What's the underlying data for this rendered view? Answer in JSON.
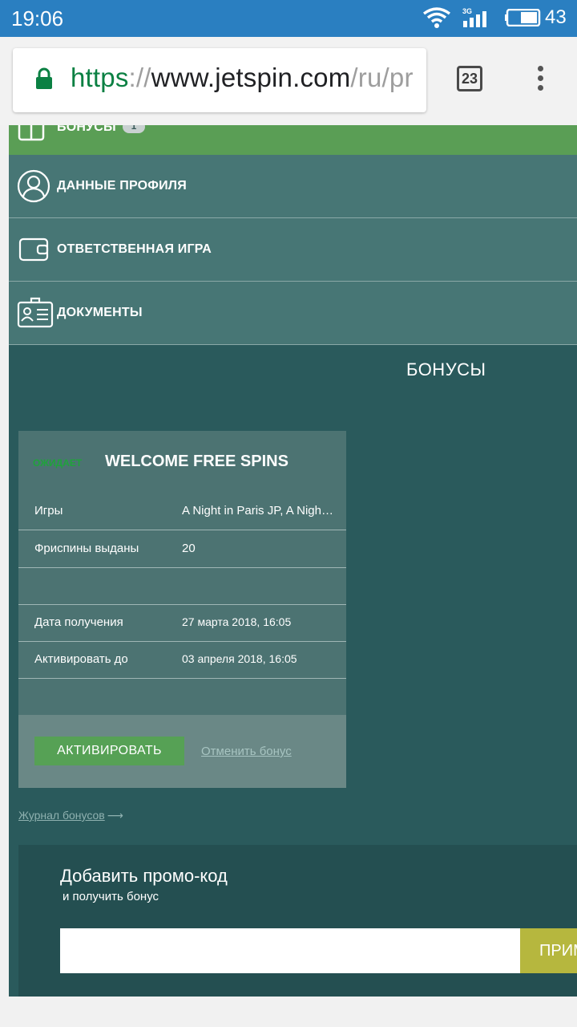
{
  "status_bar": {
    "time": "19:06",
    "network": "3G",
    "battery": "43"
  },
  "browser": {
    "url_scheme": "https",
    "url_sep": "://",
    "url_host": "www.jetspin.com",
    "url_path": "/ru/pr",
    "tab_count": "23"
  },
  "menu": {
    "items": [
      {
        "label": "БОНУСЫ",
        "badge": "1"
      },
      {
        "label": "ДАННЫЕ ПРОФИЛЯ"
      },
      {
        "label": "ОТВЕТСТВЕННАЯ ИГРА"
      },
      {
        "label": "ДОКУМЕНТЫ"
      }
    ]
  },
  "section_title": "БОНУСЫ",
  "bonus_card": {
    "status": "ОЖИДАЕТ",
    "name": "WELCOME FREE SPINS",
    "rows": [
      {
        "key": "Игры",
        "value": "A Night in Paris JP, A Night in Paris"
      },
      {
        "key": "Фриспины выданы",
        "value": "20"
      },
      {
        "key": "",
        "value": ""
      },
      {
        "key": "Дата получения",
        "value": "27 марта 2018, 16:05"
      },
      {
        "key": "Активировать до",
        "value": "03 апреля 2018, 16:05"
      },
      {
        "key": "",
        "value": ""
      }
    ],
    "activate_label": "АКТИВИРОВАТЬ",
    "cancel_label": "Отменить бонус"
  },
  "journal_link": "Журнал бонусов",
  "promo": {
    "title": "Добавить промо-код",
    "subtitle": "и получить бонус",
    "input_value": "",
    "apply_label": "ПРИМЕНИТЬ"
  },
  "colors": {
    "status_bar": "#2a7fc1",
    "menu_active": "#5a9e55",
    "menu_item": "#477675",
    "page_bg": "#2a5a5c",
    "activate_button": "#56a155",
    "apply_button": "#b6b73e"
  }
}
